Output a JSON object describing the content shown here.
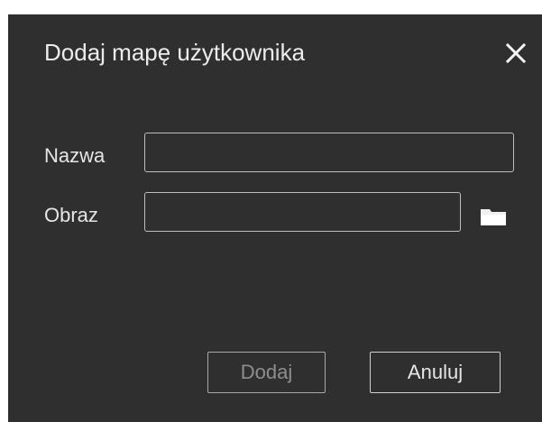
{
  "dialog": {
    "title": "Dodaj mapę użytkownika",
    "close_icon": "close-icon",
    "fields": {
      "name": {
        "label": "Nazwa",
        "value": "",
        "placeholder": ""
      },
      "image": {
        "label": "Obraz",
        "value": "",
        "placeholder": ""
      },
      "browse_icon": "folder-icon"
    },
    "buttons": {
      "add_label": "Dodaj",
      "cancel_label": "Anuluj"
    },
    "colors": {
      "background": "#2f2f2f",
      "text": "#e8e8e8",
      "disabled_text": "#8e8e8e",
      "border": "#bdbdbd"
    }
  }
}
